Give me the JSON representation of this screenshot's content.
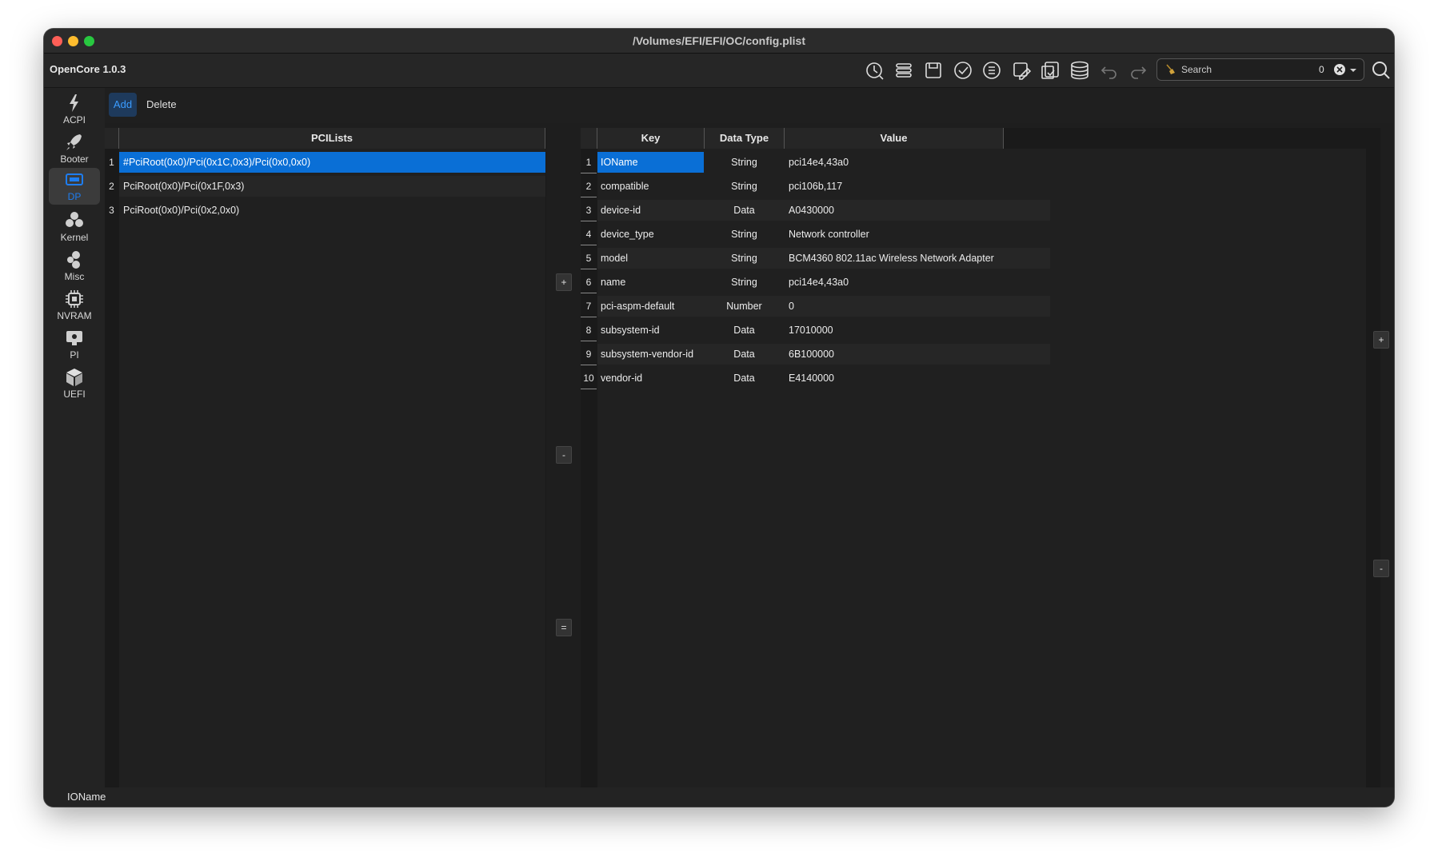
{
  "window": {
    "title": "/Volumes/EFI/EFI/OC/config.plist"
  },
  "app": {
    "name": "OpenCore 1.0.3"
  },
  "toolbar": {
    "icons": [
      "recent-files-icon",
      "list-icon",
      "save-icon",
      "check-icon",
      "compare-list-icon",
      "edit-config-icon",
      "import-icon",
      "database-icon",
      "undo-icon",
      "redo-icon"
    ],
    "search": {
      "placeholder": "Search",
      "count": "0"
    }
  },
  "sidebar": {
    "items": [
      {
        "label": "ACPI",
        "icon": "lightning-icon"
      },
      {
        "label": "Booter",
        "icon": "rocket-icon"
      },
      {
        "label": "DP",
        "icon": "display-port-icon",
        "active": true
      },
      {
        "label": "Kernel",
        "icon": "kernel-icon"
      },
      {
        "label": "Misc",
        "icon": "misc-icon"
      },
      {
        "label": "NVRAM",
        "icon": "chip-icon"
      },
      {
        "label": "PI",
        "icon": "monitor-icon"
      },
      {
        "label": "UEFI",
        "icon": "cube-icon"
      }
    ]
  },
  "subbar": {
    "add_label": "Add",
    "delete_label": "Delete"
  },
  "pci_list": {
    "header": "PCILists",
    "rows": [
      {
        "num": "1",
        "path": "#PciRoot(0x0)/Pci(0x1C,0x3)/Pci(0x0,0x0)",
        "selected": true
      },
      {
        "num": "2",
        "path": "PciRoot(0x0)/Pci(0x1F,0x3)"
      },
      {
        "num": "3",
        "path": "PciRoot(0x0)/Pci(0x2,0x0)"
      }
    ]
  },
  "middle_buttons": {
    "plus": "+",
    "minus": "-",
    "equal": "="
  },
  "properties": {
    "headers": {
      "key": "Key",
      "type": "Data Type",
      "value": "Value"
    },
    "rows": [
      {
        "num": "1",
        "key": "IOName",
        "type": "String",
        "value": "pci14e4,43a0",
        "selected": true
      },
      {
        "num": "2",
        "key": "compatible",
        "type": "String",
        "value": "pci106b,117"
      },
      {
        "num": "3",
        "key": "device-id",
        "type": "Data",
        "value": "A0430000"
      },
      {
        "num": "4",
        "key": "device_type",
        "type": "String",
        "value": "Network controller"
      },
      {
        "num": "5",
        "key": "model",
        "type": "String",
        "value": "BCM4360 802.11ac Wireless Network Adapter"
      },
      {
        "num": "6",
        "key": "name",
        "type": "String",
        "value": "pci14e4,43a0"
      },
      {
        "num": "7",
        "key": "pci-aspm-default",
        "type": "Number",
        "value": "0"
      },
      {
        "num": "8",
        "key": "subsystem-id",
        "type": "Data",
        "value": "17010000"
      },
      {
        "num": "9",
        "key": "subsystem-vendor-id",
        "type": "Data",
        "value": "6B100000"
      },
      {
        "num": "10",
        "key": "vendor-id",
        "type": "Data",
        "value": "E4140000"
      }
    ]
  },
  "right_buttons": {
    "plus": "+",
    "minus": "-"
  },
  "status": {
    "text": "IOName"
  },
  "colors": {
    "accent": "#0a6fd6",
    "background": "#1e1e1e",
    "active_label": "#1e7df0"
  }
}
